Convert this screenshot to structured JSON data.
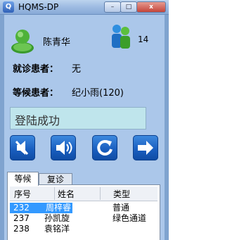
{
  "window": {
    "title": "HQMS-DP",
    "app_icon_label": "Q",
    "controls": {
      "minimize": "–",
      "maximize": "□",
      "close": "x"
    }
  },
  "doctor": {
    "name": "陈青华",
    "icon": "doctor-avatar-icon"
  },
  "waiting": {
    "count": "14",
    "icon": "people-queue-icon"
  },
  "current_patient": {
    "label": "就诊患者：",
    "value": "无"
  },
  "next_patient": {
    "label": "等候患者：",
    "value": "纪小雨(120)"
  },
  "status_message": "登陆成功",
  "action_buttons": [
    {
      "name": "mute-button",
      "icon": "speaker-mute-icon"
    },
    {
      "name": "call-button",
      "icon": "speaker-call-icon"
    },
    {
      "name": "refresh-button",
      "icon": "refresh-icon"
    },
    {
      "name": "next-button",
      "icon": "arrow-right-icon"
    }
  ],
  "tabs": [
    {
      "label": "等候",
      "active": true
    },
    {
      "label": "复诊",
      "active": false
    }
  ],
  "table": {
    "columns": [
      "序号",
      "姓名",
      "类型"
    ],
    "rows": [
      {
        "no": "232",
        "name": "周梓睿",
        "type": "普通",
        "selected": true
      },
      {
        "no": "237",
        "name": "孙凯旋",
        "type": "绿色通道",
        "selected": false
      },
      {
        "no": "238",
        "name": "袁铭洋",
        "type": "",
        "selected": false
      }
    ]
  },
  "colors": {
    "window_frame": "#7fa3cf",
    "client_bg": "#abc7ea",
    "status_bg": "#bfe5ec",
    "button_blue": "#1a5fc0",
    "selection": "#3399ff"
  }
}
